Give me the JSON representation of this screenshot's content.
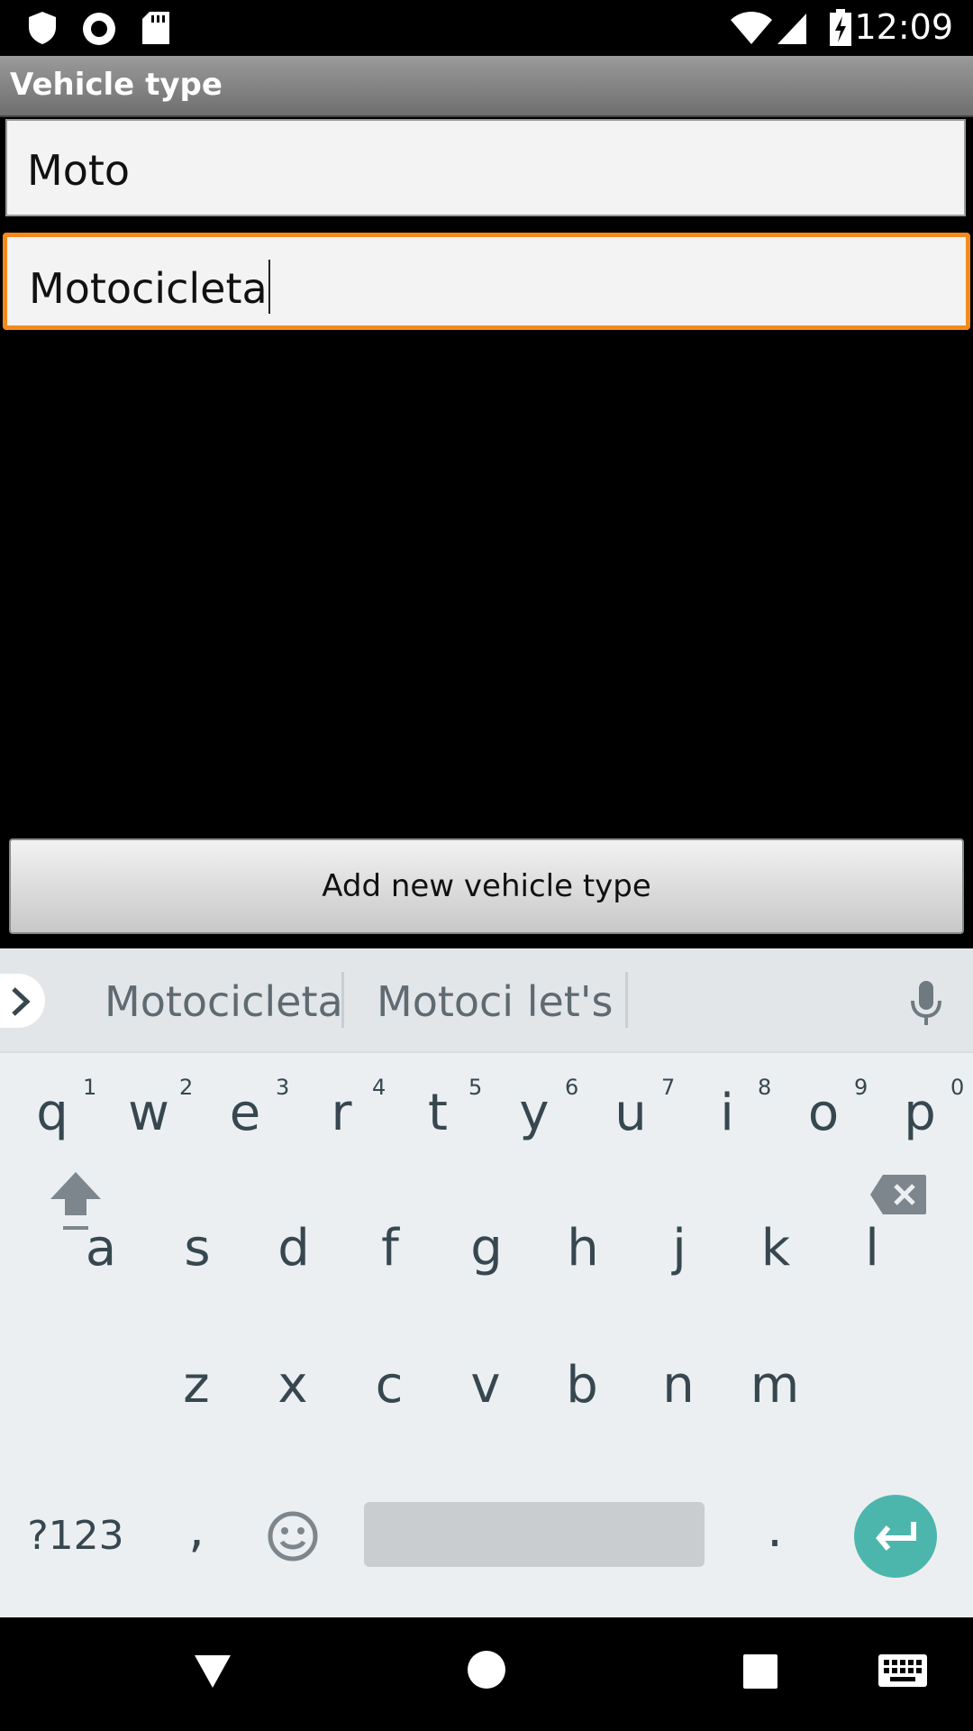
{
  "status_bar": {
    "time": "12:09",
    "left_icons": [
      "shield-icon",
      "record-icon",
      "sd-card-icon"
    ],
    "right_icons": [
      "wifi-icon",
      "signal-icon",
      "battery-charging-icon"
    ]
  },
  "title": "Vehicle type",
  "fields": {
    "short_name": "Moto",
    "full_name": "Motocicleta"
  },
  "add_button_label": "Add new vehicle type",
  "keyboard": {
    "suggestions": [
      "Motocicleta",
      "Motoci let's"
    ],
    "row1": [
      "q",
      "w",
      "e",
      "r",
      "t",
      "y",
      "u",
      "i",
      "o",
      "p"
    ],
    "row1_hints": [
      "1",
      "2",
      "3",
      "4",
      "5",
      "6",
      "7",
      "8",
      "9",
      "0"
    ],
    "row2": [
      "a",
      "s",
      "d",
      "f",
      "g",
      "h",
      "j",
      "k",
      "l"
    ],
    "row3": [
      "z",
      "x",
      "c",
      "v",
      "b",
      "n",
      "m"
    ],
    "symbols_label": "?123",
    "comma": ",",
    "period": "."
  },
  "colors": {
    "focus_border": "#f48a1d",
    "enter_key": "#4db6ac",
    "keyboard_bg": "#eceff1"
  }
}
